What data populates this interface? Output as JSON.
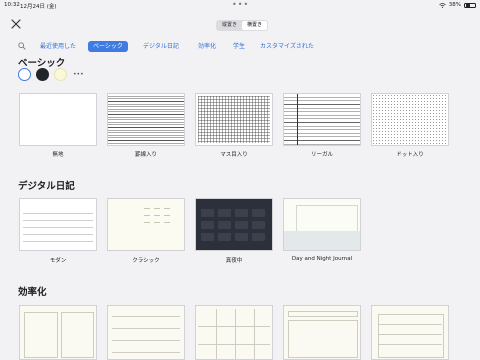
{
  "status_bar": {
    "time": "10:32",
    "date": "12月24日 (金)",
    "battery": "38%"
  },
  "segmented": {
    "options": [
      "縦置き",
      "横置き"
    ],
    "selected": "横置き"
  },
  "tabs": [
    "最近使用した",
    "ベーシック",
    "デジタル日記",
    "効率化",
    "学生",
    "カスタマイズされた"
  ],
  "active_tab": "ベーシック",
  "colors": {
    "accent": "#3f7be0",
    "swatches": [
      "#ffffff",
      "#22252b",
      "#fbf8d8"
    ]
  },
  "sections": {
    "basic": {
      "title": "ベーシック",
      "templates": [
        "無地",
        "罫線入り",
        "マス目入り",
        "リーガル",
        "ドット入り"
      ]
    },
    "digital_diary": {
      "title": "デジタル日記",
      "templates": [
        "モダン",
        "クラシック",
        "真夜中",
        "Day and Night Journal"
      ]
    },
    "efficiency": {
      "title": "効率化"
    }
  },
  "icons": [
    "close-icon",
    "search-icon",
    "more-icon",
    "wifi-icon",
    "battery-icon"
  ]
}
